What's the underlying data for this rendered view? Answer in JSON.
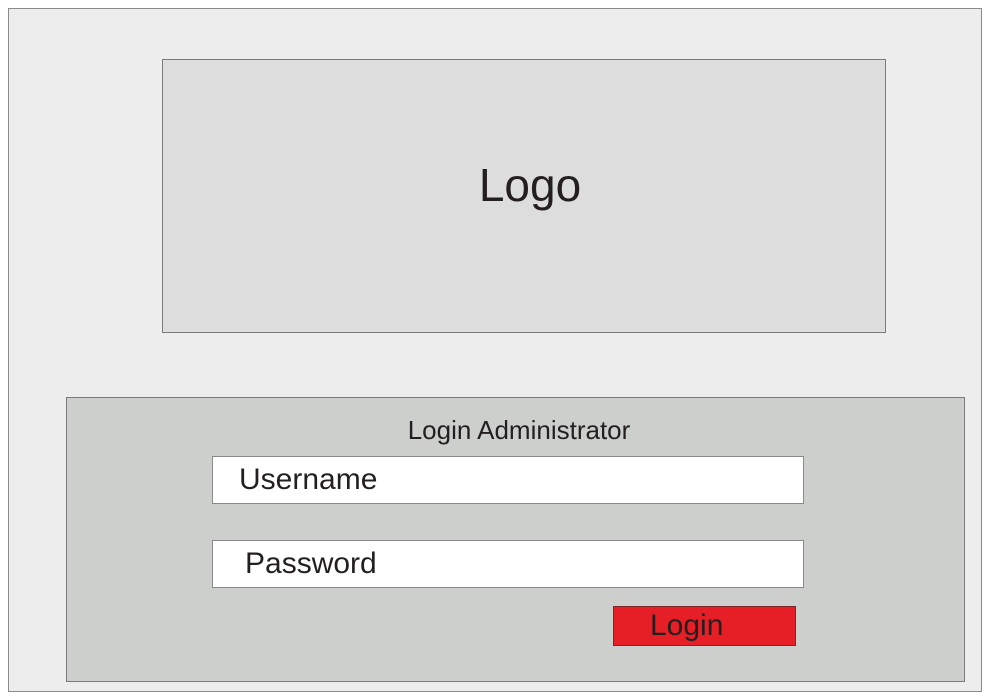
{
  "logo": {
    "text": "Logo"
  },
  "login": {
    "title": "Login Administrator",
    "username_placeholder": "Username",
    "password_placeholder": "Password",
    "button_label": "Login"
  },
  "colors": {
    "background": "#ededed",
    "logo_box": "#dcdddc",
    "panel": "#cdcfcd",
    "button": "#e61e25"
  }
}
